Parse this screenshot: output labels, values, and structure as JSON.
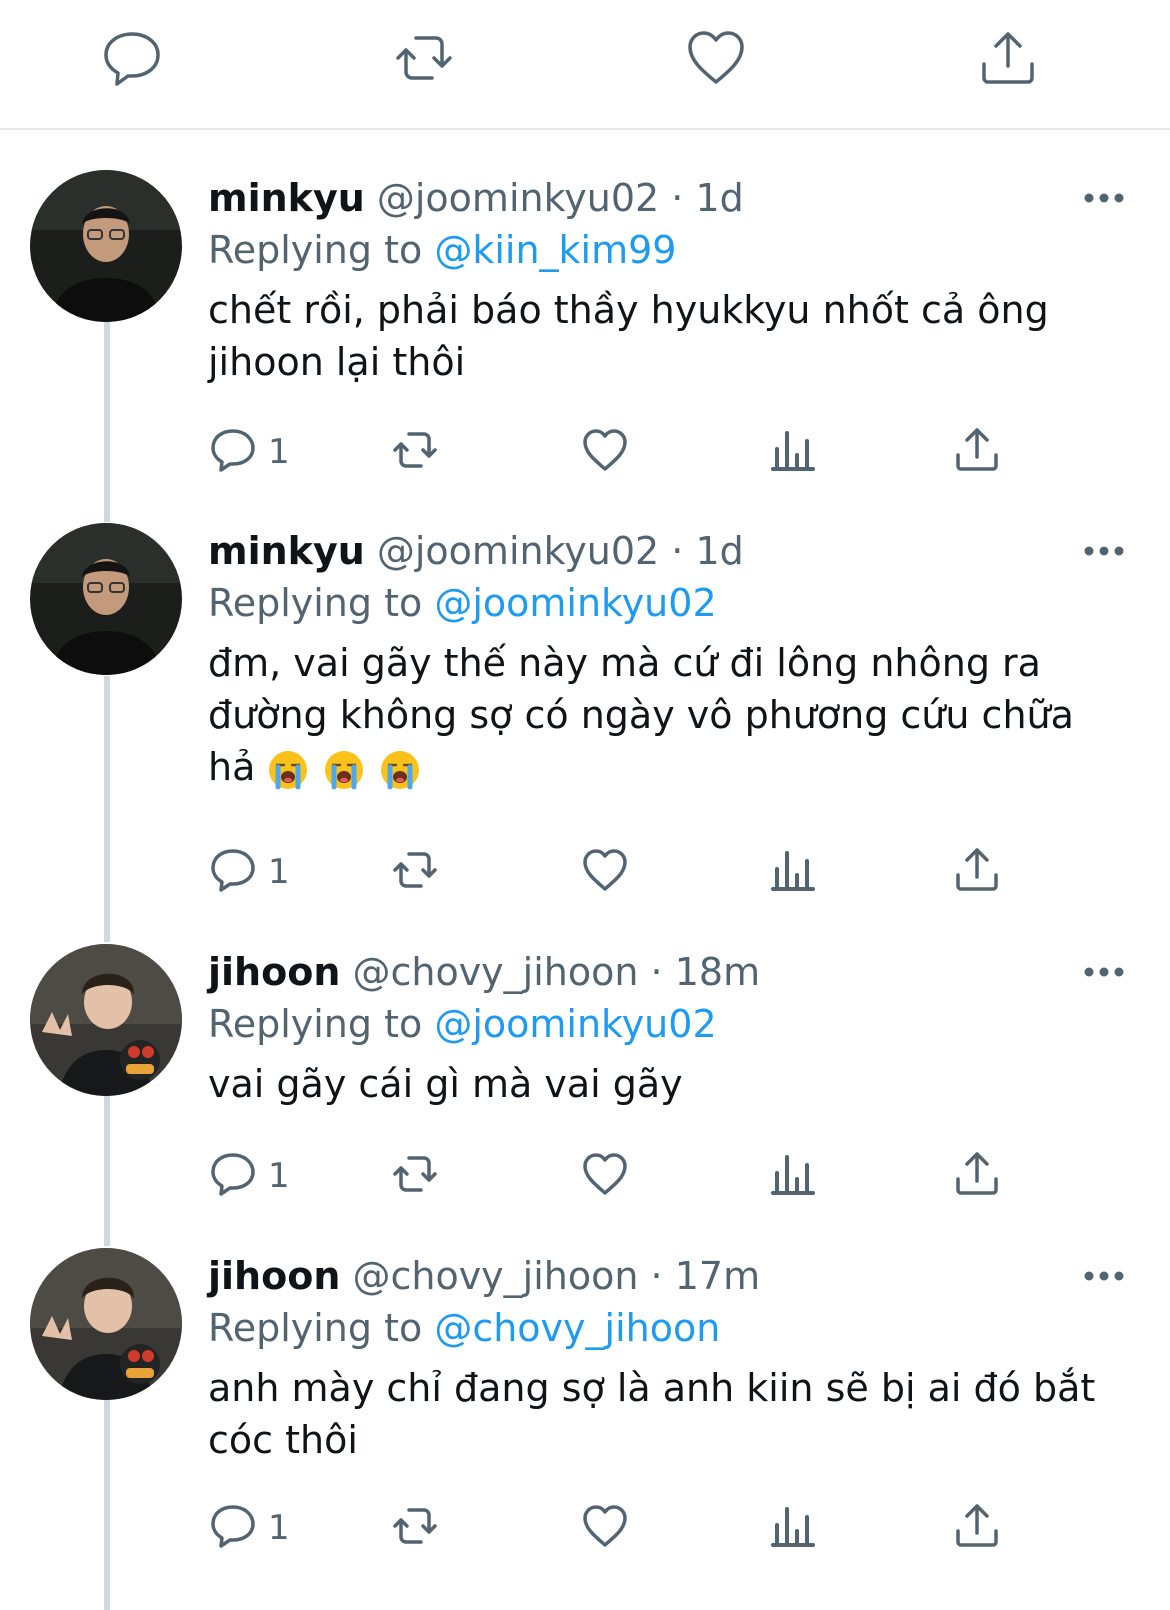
{
  "top_actions": {
    "icons": [
      "reply-icon",
      "retweet-icon",
      "like-icon",
      "share-icon"
    ]
  },
  "tweets": [
    {
      "name": "minkyu",
      "handle": "@joominkyu02",
      "separator": "·",
      "time": "1d",
      "replying_prefix": "Replying to",
      "replying_to": "@kiin_kim99",
      "text": "chết rồi, phải báo thầy hyukkyu nhốt cả ông\njihoon lại thôi",
      "emojis": [],
      "reply_count": "1",
      "avatar": "minkyu"
    },
    {
      "name": "minkyu",
      "handle": "@joominkyu02",
      "separator": "·",
      "time": "1d",
      "replying_prefix": "Replying to",
      "replying_to": "@joominkyu02",
      "text": "đm, vai gãy thế này mà cứ đi lông nhông ra\nđường không sợ có ngày vô phương cứu chữa\nhả",
      "emojis": [
        "loudly-crying-face",
        "loudly-crying-face",
        "loudly-crying-face"
      ],
      "reply_count": "1",
      "avatar": "minkyu"
    },
    {
      "name": "jihoon",
      "handle": "@chovy_jihoon",
      "separator": "·",
      "time": "18m",
      "replying_prefix": "Replying to",
      "replying_to": "@joominkyu02",
      "text": "vai gãy cái gì mà vai gãy",
      "emojis": [],
      "reply_count": "1",
      "avatar": "jihoon"
    },
    {
      "name": "jihoon",
      "handle": "@chovy_jihoon",
      "separator": "·",
      "time": "17m",
      "replying_prefix": "Replying to",
      "replying_to": "@chovy_jihoon",
      "text": "anh mày chỉ đang sợ là anh kiin sẽ bị ai đó bắt\ncóc thôi",
      "emojis": [],
      "reply_count": "1",
      "avatar": "jihoon"
    }
  ],
  "colors": {
    "text": "#0f1419",
    "secondary": "#536471",
    "link": "#1d9bf0",
    "divider": "#e6e9eb",
    "thread_line": "#cfd9de"
  }
}
